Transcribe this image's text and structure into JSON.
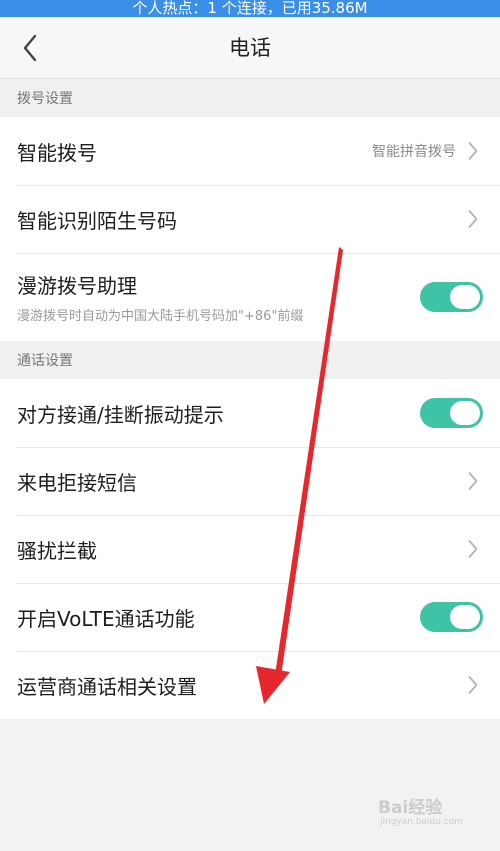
{
  "status_bar": {
    "text": "个人热点：1 个连接，已用35.86M"
  },
  "header": {
    "title": "电话"
  },
  "sections": [
    {
      "title": "拨号设置",
      "items": [
        {
          "label": "智能拨号",
          "value": "智能拼音拨号",
          "control": "chevron"
        },
        {
          "label": "智能识别陌生号码",
          "control": "chevron"
        },
        {
          "label": "漫游拨号助理",
          "sublabel": "漫游拨号时自动为中国大陆手机号码加\"+86\"前缀",
          "control": "toggle",
          "state": "on"
        }
      ]
    },
    {
      "title": "通话设置",
      "items": [
        {
          "label": "对方接通/挂断振动提示",
          "control": "toggle",
          "state": "on"
        },
        {
          "label": "来电拒接短信",
          "control": "chevron"
        },
        {
          "label": "骚扰拦截",
          "control": "chevron"
        },
        {
          "label": "开启VoLTE通话功能",
          "control": "toggle",
          "state": "on"
        },
        {
          "label": "运营商通话相关设置",
          "control": "chevron"
        }
      ]
    }
  ],
  "colors": {
    "status_bar": "#3a8ee8",
    "toggle_on": "#3fc3a6",
    "annotation_arrow": "#e8262d"
  },
  "icons": {
    "back": "back-arrow-icon",
    "chevron": "chevron-right-icon"
  },
  "watermark": {
    "brand": "Bai经验",
    "domain": "jingyan.baidu.com"
  }
}
